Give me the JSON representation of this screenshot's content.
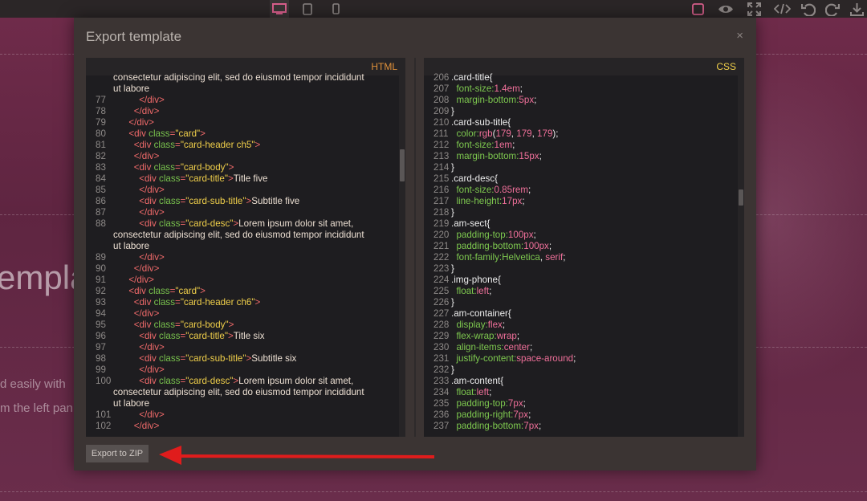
{
  "toolbar": {
    "left_icons": [
      "desktop-icon",
      "tablet-icon",
      "mobile-icon"
    ],
    "right_icons": [
      "square-border-icon",
      "eye-icon",
      "fullscreen-icon",
      "code-icon",
      "undo-icon",
      "redo-icon",
      "download-icon"
    ],
    "active_color": "#d95f8c"
  },
  "background": {
    "title_fragment": "empla",
    "text_line_1": "d easily with",
    "text_line_2": "m the left pan"
  },
  "modal": {
    "title": "Export template",
    "close_symbol": "×",
    "export_button": "Export to ZIP"
  },
  "html_panel": {
    "label": "HTML",
    "label_color": "#e0913a",
    "lines": [
      {
        "n": "",
        "html": "<span class=\"s\">consectetur adipiscing elit, sed do eiusmod tempor incididunt</span>"
      },
      {
        "n": "",
        "html": "<span class=\"s\">ut labore</span>"
      },
      {
        "n": "77",
        "html": "          <span class=\"t\">&lt;/div&gt;</span>"
      },
      {
        "n": "78",
        "html": "        <span class=\"t\">&lt;/div&gt;</span>"
      },
      {
        "n": "79",
        "html": "      <span class=\"t\">&lt;/div&gt;</span>"
      },
      {
        "n": "80",
        "html": "      <span class=\"t\">&lt;div</span> <span class=\"a\">class</span><span class=\"t\">=</span><span class=\"v\">\"card\"</span><span class=\"t\">&gt;</span>"
      },
      {
        "n": "81",
        "html": "        <span class=\"t\">&lt;div</span> <span class=\"a\">class</span><span class=\"t\">=</span><span class=\"v\">\"card-header ch5\"</span><span class=\"t\">&gt;</span>"
      },
      {
        "n": "82",
        "html": "        <span class=\"t\">&lt;/div&gt;</span>"
      },
      {
        "n": "83",
        "html": "        <span class=\"t\">&lt;div</span> <span class=\"a\">class</span><span class=\"t\">=</span><span class=\"v\">\"card-body\"</span><span class=\"t\">&gt;</span>"
      },
      {
        "n": "84",
        "html": "          <span class=\"t\">&lt;div</span> <span class=\"a\">class</span><span class=\"t\">=</span><span class=\"v\">\"card-title\"</span><span class=\"t\">&gt;</span><span class=\"s\">Title five</span>"
      },
      {
        "n": "85",
        "html": "          <span class=\"t\">&lt;/div&gt;</span>"
      },
      {
        "n": "86",
        "html": "          <span class=\"t\">&lt;div</span> <span class=\"a\">class</span><span class=\"t\">=</span><span class=\"v\">\"card-sub-title\"</span><span class=\"t\">&gt;</span><span class=\"s\">Subtitle five</span>"
      },
      {
        "n": "87",
        "html": "          <span class=\"t\">&lt;/div&gt;</span>"
      },
      {
        "n": "88",
        "html": "          <span class=\"t\">&lt;div</span> <span class=\"a\">class</span><span class=\"t\">=</span><span class=\"v\">\"card-desc\"</span><span class=\"t\">&gt;</span><span class=\"s\">Lorem ipsum dolor sit amet,</span>"
      },
      {
        "n": "",
        "html": "<span class=\"s\">consectetur adipiscing elit, sed do eiusmod tempor incididunt</span>"
      },
      {
        "n": "",
        "html": "<span class=\"s\">ut labore</span>"
      },
      {
        "n": "89",
        "html": "          <span class=\"t\">&lt;/div&gt;</span>"
      },
      {
        "n": "90",
        "html": "        <span class=\"t\">&lt;/div&gt;</span>"
      },
      {
        "n": "91",
        "html": "      <span class=\"t\">&lt;/div&gt;</span>"
      },
      {
        "n": "92",
        "html": "      <span class=\"t\">&lt;div</span> <span class=\"a\">class</span><span class=\"t\">=</span><span class=\"v\">\"card\"</span><span class=\"t\">&gt;</span>"
      },
      {
        "n": "93",
        "html": "        <span class=\"t\">&lt;div</span> <span class=\"a\">class</span><span class=\"t\">=</span><span class=\"v\">\"card-header ch6\"</span><span class=\"t\">&gt;</span>"
      },
      {
        "n": "94",
        "html": "        <span class=\"t\">&lt;/div&gt;</span>"
      },
      {
        "n": "95",
        "html": "        <span class=\"t\">&lt;div</span> <span class=\"a\">class</span><span class=\"t\">=</span><span class=\"v\">\"card-body\"</span><span class=\"t\">&gt;</span>"
      },
      {
        "n": "96",
        "html": "          <span class=\"t\">&lt;div</span> <span class=\"a\">class</span><span class=\"t\">=</span><span class=\"v\">\"card-title\"</span><span class=\"t\">&gt;</span><span class=\"s\">Title six</span>"
      },
      {
        "n": "97",
        "html": "          <span class=\"t\">&lt;/div&gt;</span>"
      },
      {
        "n": "98",
        "html": "          <span class=\"t\">&lt;div</span> <span class=\"a\">class</span><span class=\"t\">=</span><span class=\"v\">\"card-sub-title\"</span><span class=\"t\">&gt;</span><span class=\"s\">Subtitle six</span>"
      },
      {
        "n": "99",
        "html": "          <span class=\"t\">&lt;/div&gt;</span>"
      },
      {
        "n": "100",
        "html": "          <span class=\"t\">&lt;div</span> <span class=\"a\">class</span><span class=\"t\">=</span><span class=\"v\">\"card-desc\"</span><span class=\"t\">&gt;</span><span class=\"s\">Lorem ipsum dolor sit amet,</span>"
      },
      {
        "n": "",
        "html": "<span class=\"s\">consectetur adipiscing elit, sed do eiusmod tempor incididunt</span>"
      },
      {
        "n": "",
        "html": "<span class=\"s\">ut labore</span>"
      },
      {
        "n": "101",
        "html": "          <span class=\"t\">&lt;/div&gt;</span>"
      },
      {
        "n": "102",
        "html": "        <span class=\"t\">&lt;/div&gt;</span>"
      }
    ]
  },
  "css_panel": {
    "label": "CSS",
    "label_color": "#f0cf4a",
    "lines": [
      {
        "n": "206",
        "html": "<span class=\"sel\">.card-title{</span>"
      },
      {
        "n": "207",
        "html": "  <span class=\"prop\">font-size:</span><span class=\"val\">1.4em</span><span class=\"sel\">;</span>"
      },
      {
        "n": "208",
        "html": "  <span class=\"prop\">margin-bottom:</span><span class=\"val\">5px</span><span class=\"sel\">;</span>"
      },
      {
        "n": "209",
        "html": "<span class=\"sel\">}</span>"
      },
      {
        "n": "210",
        "html": "<span class=\"sel\">.card-sub-title{</span>"
      },
      {
        "n": "211",
        "html": "  <span class=\"prop\">color:</span><span class=\"val\">rgb</span><span class=\"sel\">(</span><span class=\"val\">179</span><span class=\"sel\">, </span><span class=\"val\">179</span><span class=\"sel\">, </span><span class=\"val\">179</span><span class=\"sel\">);</span>"
      },
      {
        "n": "212",
        "html": "  <span class=\"prop\">font-size:</span><span class=\"val\">1em</span><span class=\"sel\">;</span>"
      },
      {
        "n": "213",
        "html": "  <span class=\"prop\">margin-bottom:</span><span class=\"val\">15px</span><span class=\"sel\">;</span>"
      },
      {
        "n": "214",
        "html": "<span class=\"sel\">}</span>"
      },
      {
        "n": "215",
        "html": "<span class=\"sel\">.card-desc{</span>"
      },
      {
        "n": "216",
        "html": "  <span class=\"prop\">font-size:</span><span class=\"val\">0.85rem</span><span class=\"sel\">;</span>"
      },
      {
        "n": "217",
        "html": "  <span class=\"prop\">line-height:</span><span class=\"val\">17px</span><span class=\"sel\">;</span>"
      },
      {
        "n": "218",
        "html": "<span class=\"sel\">}</span>"
      },
      {
        "n": "219",
        "html": "<span class=\"sel\">.am-sect{</span>"
      },
      {
        "n": "220",
        "html": "  <span class=\"prop\">padding-top:</span><span class=\"val\">100px</span><span class=\"sel\">;</span>"
      },
      {
        "n": "221",
        "html": "  <span class=\"prop\">padding-bottom:</span><span class=\"val\">100px</span><span class=\"sel\">;</span>"
      },
      {
        "n": "222",
        "html": "  <span class=\"prop\">font-family:</span><span class=\"prop\">Helvetica</span><span class=\"sel\">, </span><span class=\"val\">serif</span><span class=\"sel\">;</span>"
      },
      {
        "n": "223",
        "html": "<span class=\"sel\">}</span>"
      },
      {
        "n": "224",
        "html": "<span class=\"sel\">.img-phone{</span>"
      },
      {
        "n": "225",
        "html": "  <span class=\"prop\">float:</span><span class=\"val\">left</span><span class=\"sel\">;</span>"
      },
      {
        "n": "226",
        "html": "<span class=\"sel\">}</span>"
      },
      {
        "n": "227",
        "html": "<span class=\"sel\">.am-container{</span>"
      },
      {
        "n": "228",
        "html": "  <span class=\"prop\">display:</span><span class=\"val\">flex</span><span class=\"sel\">;</span>"
      },
      {
        "n": "229",
        "html": "  <span class=\"prop\">flex-wrap:</span><span class=\"val\">wrap</span><span class=\"sel\">;</span>"
      },
      {
        "n": "230",
        "html": "  <span class=\"prop\">align-items:</span><span class=\"val\">center</span><span class=\"sel\">;</span>"
      },
      {
        "n": "231",
        "html": "  <span class=\"prop\">justify-content:</span><span class=\"val\">space-around</span><span class=\"sel\">;</span>"
      },
      {
        "n": "232",
        "html": "<span class=\"sel\">}</span>"
      },
      {
        "n": "233",
        "html": "<span class=\"sel\">.am-content{</span>"
      },
      {
        "n": "234",
        "html": "  <span class=\"prop\">float:</span><span class=\"val\">left</span><span class=\"sel\">;</span>"
      },
      {
        "n": "235",
        "html": "  <span class=\"prop\">padding-top:</span><span class=\"val\">7px</span><span class=\"sel\">;</span>"
      },
      {
        "n": "236",
        "html": "  <span class=\"prop\">padding-right:</span><span class=\"val\">7px</span><span class=\"sel\">;</span>"
      },
      {
        "n": "237",
        "html": "  <span class=\"prop\">padding-bottom:</span><span class=\"val\">7px</span><span class=\"sel\">;</span>"
      }
    ]
  }
}
